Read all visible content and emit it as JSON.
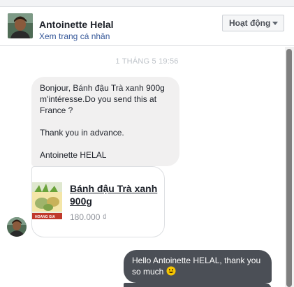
{
  "header": {
    "contact_name": "Antoinette Helal",
    "profile_link": "Xem trang cá nhân",
    "status_label": "Hoạt động"
  },
  "conversation": {
    "timestamp": "1 THÁNG 5 19:56",
    "incoming_lines": [
      "Bonjour, Bánh đậu Trà xanh 900g",
      "m'intéresse.Do you send this at",
      "France ?",
      "",
      "Thank you in advance.",
      "",
      "Antoinette HELAL"
    ],
    "product": {
      "name": "Bánh đậu Trà xanh 900g",
      "price": "180.000 ₫",
      "image_label": "HOANG GIA"
    },
    "outgoing_text": "Hello Antoinette HELAL, thank you so much",
    "outgoing_emoji": "smile-emoji"
  },
  "colors": {
    "link": "#365899",
    "incoming_bubble": "#f1f0f0",
    "outgoing_bubble": "#4b4f56"
  }
}
